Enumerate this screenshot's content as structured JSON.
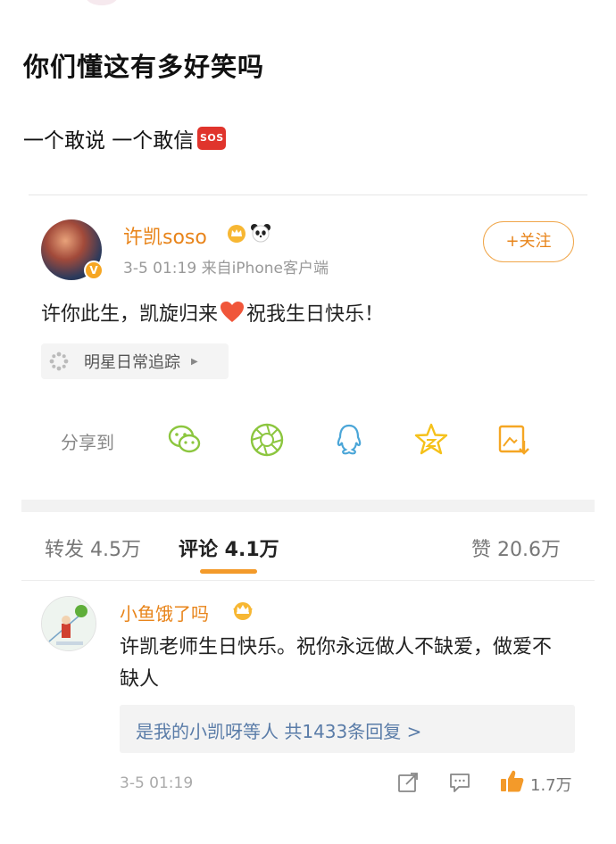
{
  "post": {
    "title": "你们懂这有多好笑吗",
    "subtitle": "一个敢说 一个敢信",
    "sos_label": "SOS"
  },
  "weibo": {
    "author": {
      "name": "许凯soso",
      "meta": "3-5 01:19  来自iPhone客户端",
      "verified_mark": "V"
    },
    "follow_label": "+关注",
    "text_before_heart": "许你此生，凯旋归来",
    "text_after_heart": "祝我生日快乐！",
    "topic": {
      "label": "明星日常追踪",
      "arrow": "▶"
    },
    "share": {
      "label": "分享到",
      "icons": [
        "wechat-icon",
        "moments-icon",
        "qq-icon",
        "qzone-icon",
        "save-image-icon"
      ],
      "color": "#8cc63f"
    },
    "tabs": [
      {
        "label": "转发 4.5万"
      },
      {
        "label": "评论 4.1万"
      },
      {
        "label": "赞 20.6万"
      }
    ],
    "active_tab": 1,
    "accent_color": "#e8841a",
    "comment": {
      "name": "小鱼饿了吗",
      "text": "许凯老师生日快乐。祝你永远做人不缺爱，做爱不缺人",
      "reply_summary": "是我的小凯呀等人  共1433条回复 >",
      "time": "3-5 01:19",
      "like_count": "1.7万"
    }
  }
}
